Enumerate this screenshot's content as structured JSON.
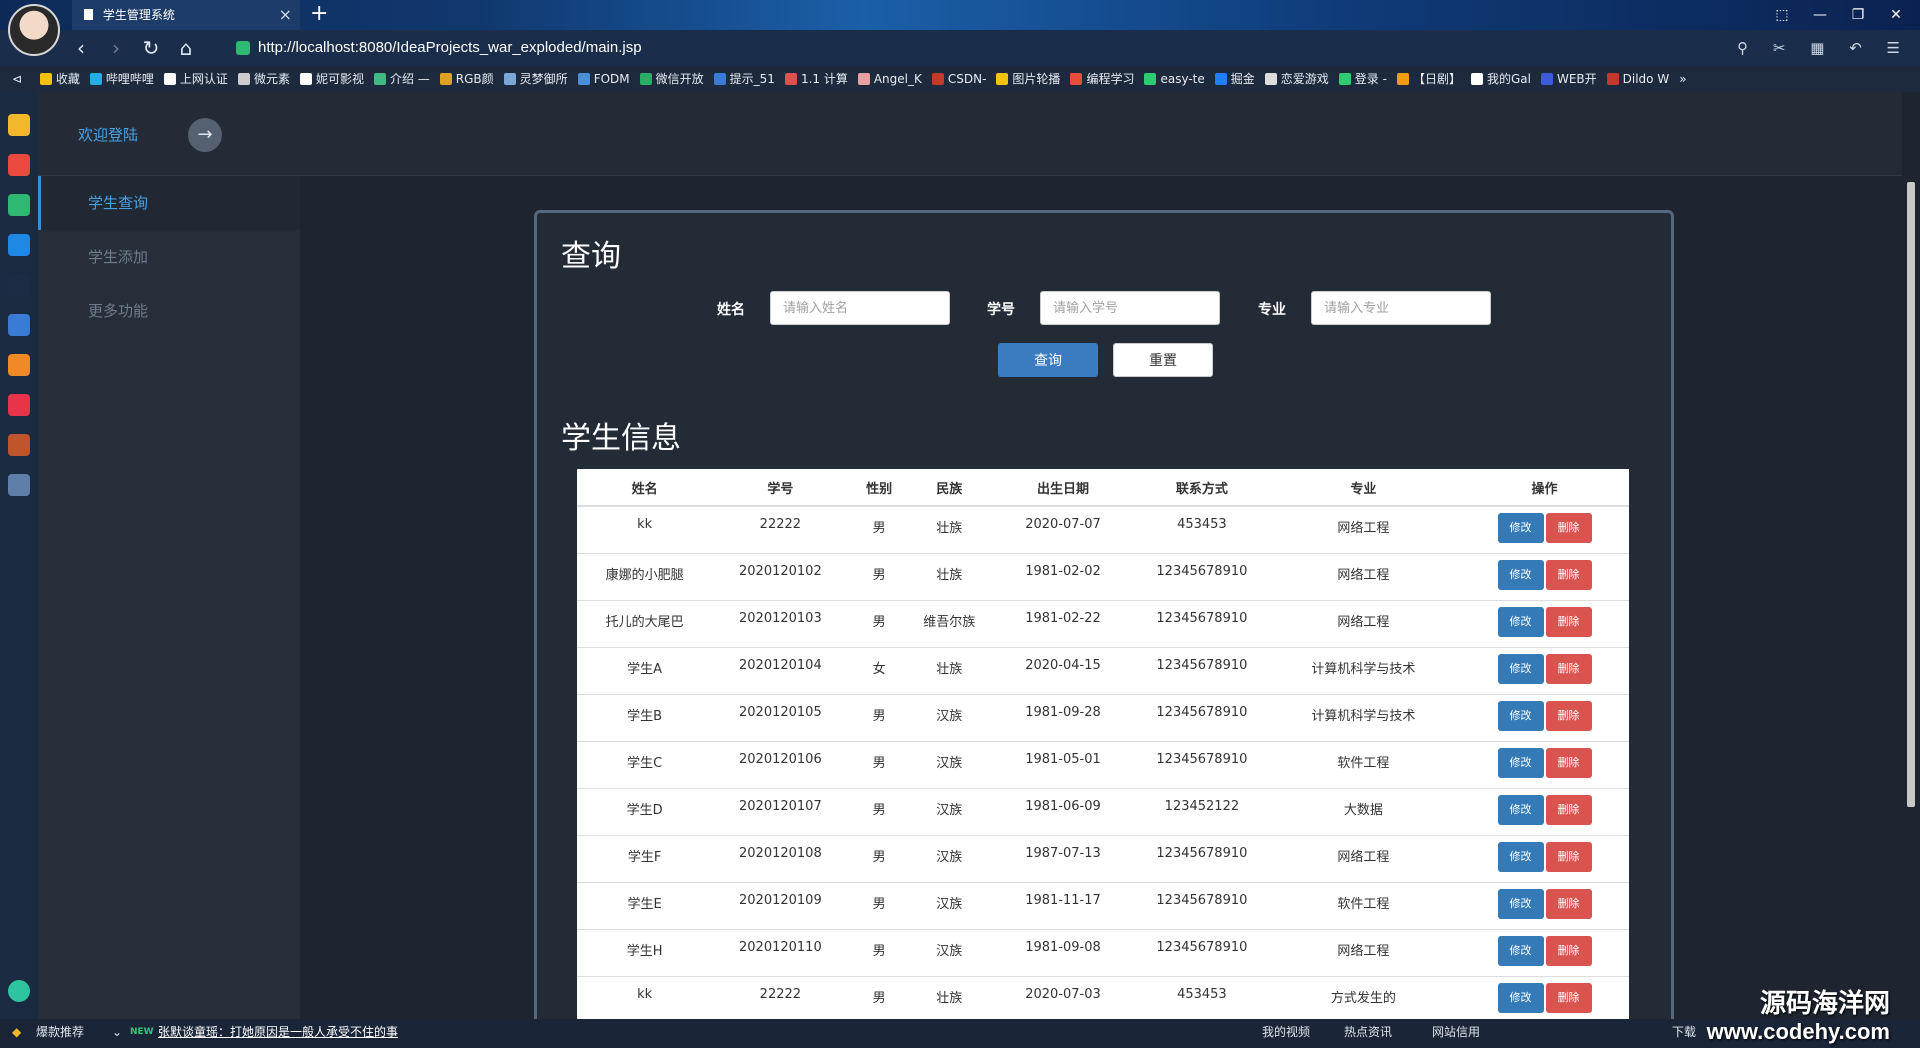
{
  "browser": {
    "tab_title": "学生管理系统",
    "tab_close": "×",
    "new_tab": "+",
    "url": "http://localhost:8080/IdeaProjects_war_exploded/main.jsp",
    "window_controls": [
      "⬚",
      "—",
      "❐",
      "✕"
    ],
    "nav": {
      "back": "‹",
      "forward": "›",
      "reload": "↻",
      "home": "⌂"
    },
    "bookmarks": [
      "收藏",
      "哔哩哔哩",
      "上网认证",
      "微元素",
      "妮可影视",
      "介绍 —",
      "RGB颜",
      "灵梦御所",
      "FODM",
      "微信开放",
      "提示_51",
      "1.1 计算",
      "Angel_K",
      "CSDN-",
      "图片轮播",
      "编程学习",
      "easy-te",
      "掘金",
      "恋爱游戏",
      "登录 -",
      "【日剧】",
      "我的Gal",
      "WEB开",
      "Dildo W",
      "»"
    ],
    "bookmark_colors": [
      "#f4c20d",
      "#23ade5",
      "#ffffff",
      "#cccccc",
      "#ffffff",
      "#42b883",
      "#e0a020",
      "#7aa7d8",
      "#4a90d9",
      "#2aae67",
      "#3a7bd5",
      "#d9534f",
      "#e8a0a0",
      "#c0392b",
      "#f1c40f",
      "#e74c3c",
      "#2ecc71",
      "#1e80ff",
      "#dddddd",
      "#2ecc71",
      "#f39c12",
      "#ffffff",
      "#3b5bdb",
      "#c0392b",
      "#ffffff"
    ]
  },
  "header": {
    "welcome": "欢迎登陆",
    "arrow": "→"
  },
  "sidebar": {
    "items": [
      {
        "label": "学生查询",
        "active": true
      },
      {
        "label": "学生添加",
        "active": false
      },
      {
        "label": "更多功能",
        "active": false
      }
    ]
  },
  "query": {
    "title": "查询",
    "name_label": "姓名",
    "name_placeholder": "请输入姓名",
    "id_label": "学号",
    "id_placeholder": "请输入学号",
    "major_label": "专业",
    "major_placeholder": "请输入专业",
    "search_button": "查询",
    "reset_button": "重置"
  },
  "students": {
    "title": "学生信息",
    "columns": [
      "姓名",
      "学号",
      "性别",
      "民族",
      "出生日期",
      "联系方式",
      "专业",
      "操作"
    ],
    "edit_label": "修改",
    "delete_label": "删除",
    "rows": [
      [
        "kk",
        "22222",
        "男",
        "壮族",
        "2020-07-07",
        "453453",
        "网络工程"
      ],
      [
        "康娜的小肥腿",
        "2020120102",
        "男",
        "壮族",
        "1981-02-02",
        "12345678910",
        "网络工程"
      ],
      [
        "托儿的大尾巴",
        "2020120103",
        "男",
        "维吾尔族",
        "1981-02-22",
        "12345678910",
        "网络工程"
      ],
      [
        "学生A",
        "2020120104",
        "女",
        "壮族",
        "2020-04-15",
        "12345678910",
        "计算机科学与技术"
      ],
      [
        "学生B",
        "2020120105",
        "男",
        "汉族",
        "1981-09-28",
        "12345678910",
        "计算机科学与技术"
      ],
      [
        "学生C",
        "2020120106",
        "男",
        "汉族",
        "1981-05-01",
        "12345678910",
        "软件工程"
      ],
      [
        "学生D",
        "2020120107",
        "男",
        "汉族",
        "1981-06-09",
        "123452122",
        "大数据"
      ],
      [
        "学生F",
        "2020120108",
        "男",
        "汉族",
        "1987-07-13",
        "12345678910",
        "网络工程"
      ],
      [
        "学生E",
        "2020120109",
        "男",
        "汉族",
        "1981-11-17",
        "12345678910",
        "软件工程"
      ],
      [
        "学生H",
        "2020120110",
        "男",
        "汉族",
        "1981-09-08",
        "12345678910",
        "网络工程"
      ],
      [
        "kk",
        "22222",
        "男",
        "壮族",
        "2020-07-03",
        "453453",
        "方式发生的"
      ]
    ]
  },
  "statusbar": {
    "hot": "爆款推荐",
    "news_badge": "NEW",
    "news": "张默谈童瑶：打她原因是一般人承受不住的事",
    "my_video": "我的视频",
    "hot_news": "热点资讯",
    "site_trust": "网站信用",
    "download": "下载"
  },
  "watermark": {
    "line1": "源码海洋网",
    "line2": "www.codehy.com"
  },
  "colors": {
    "accent": "#4aa1e0",
    "primary_button": "#3b7bc0",
    "edit_button": "#337ab7",
    "delete_button": "#d9534f",
    "page_bg": "#1e2530"
  }
}
